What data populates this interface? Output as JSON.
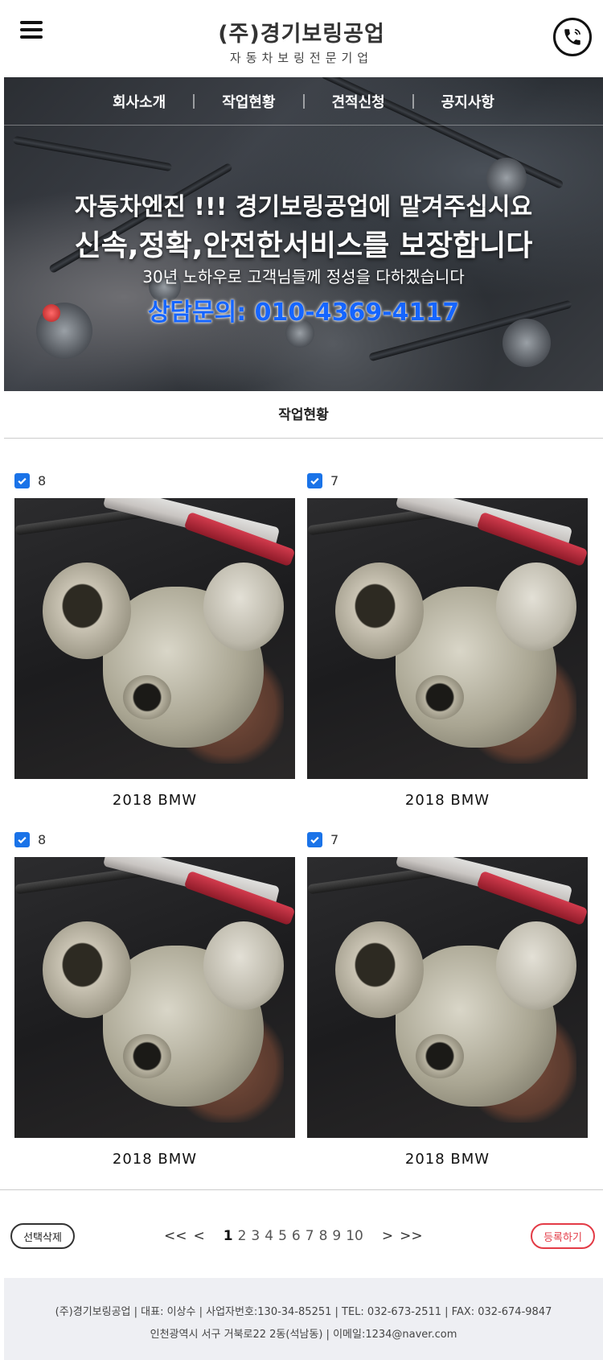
{
  "header": {
    "company_name": "(주)경기보링공업",
    "company_tagline": "자동차보링전문기업",
    "menu_icon": "hamburger-menu-icon",
    "phone_icon": "phone-icon"
  },
  "nav": {
    "items": [
      {
        "label": "회사소개"
      },
      {
        "label": "작업현황"
      },
      {
        "label": "견적신청"
      },
      {
        "label": "공지사항"
      }
    ]
  },
  "hero": {
    "line1": "자동차엔진 !!! 경기보링공업에 맡겨주십시요",
    "line2": "신속,정확,안전한서비스를 보장합니다",
    "line3": "30년 노하우로 고객님들께 정성을 다하겠습니다",
    "contact": "상담문의: 010-4369-4117",
    "contact_color": "#1565ff"
  },
  "section": {
    "title": "작업현황"
  },
  "gallery": {
    "items": [
      {
        "number": "8",
        "checked": true,
        "caption": "2018 BMW"
      },
      {
        "number": "7",
        "checked": true,
        "caption": "2018 BMW"
      },
      {
        "number": "8",
        "checked": true,
        "caption": "2018 BMW"
      },
      {
        "number": "7",
        "checked": true,
        "caption": "2018 BMW"
      }
    ]
  },
  "controls": {
    "delete_label": "선택삭제",
    "register_label": "등록하기",
    "first_label": "<<",
    "prev_label": "<",
    "next_label": ">",
    "last_label": ">>",
    "pages": [
      "1",
      "2",
      "3",
      "4",
      "5",
      "6",
      "7",
      "8",
      "9",
      "10"
    ],
    "current_page": "1",
    "register_color": "#e33b46"
  },
  "footer": {
    "line1": "(주)경기보링공업  |  대표: 이상수  |  사업자번호:130-34-85251  |  TEL: 032-673-2511  |  FAX: 032-674-9847",
    "line2": "인천광역시 서구 거북로22 2동(석남동)  |  이메일:1234@naver.com"
  }
}
